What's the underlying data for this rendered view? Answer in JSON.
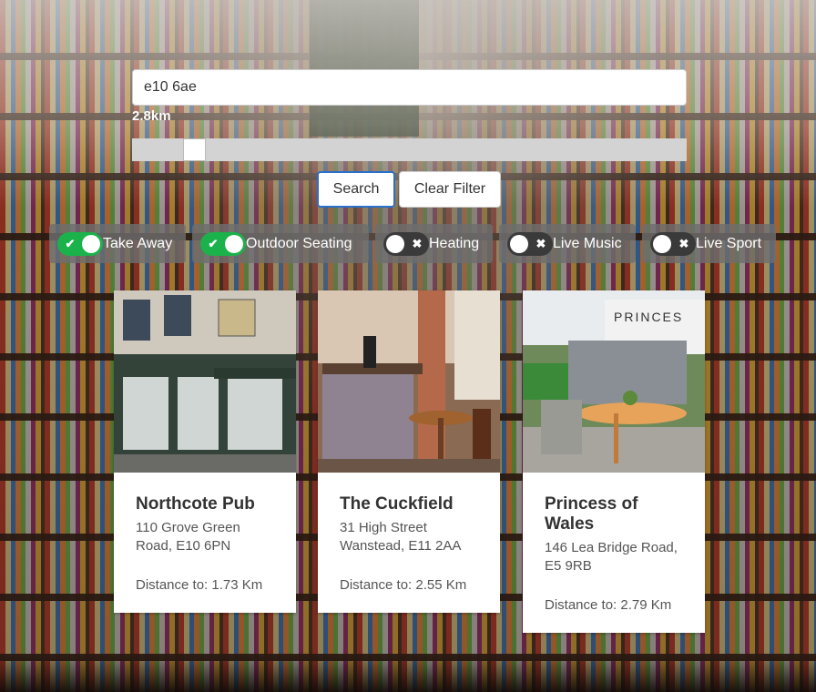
{
  "search": {
    "value": "e10 6ae",
    "distance_label": "2.8km",
    "slider_fraction": 0.11
  },
  "buttons": {
    "search_label": "Search",
    "clear_label": "Clear Filter"
  },
  "filters": [
    {
      "label": "Take Away",
      "on": true,
      "icon": "check-icon"
    },
    {
      "label": "Outdoor Seating",
      "on": true,
      "icon": "check-icon"
    },
    {
      "label": "Heating",
      "on": false,
      "icon": "x-icon"
    },
    {
      "label": "Live Music",
      "on": false,
      "icon": "x-icon"
    },
    {
      "label": "Live Sport",
      "on": false,
      "icon": "x-icon"
    }
  ],
  "pubs": [
    {
      "name": "Northcote Pub",
      "address": "110 Grove Green Road, E10 6PN",
      "distance": "Distance to: 1.73 Km"
    },
    {
      "name": "The Cuckfield",
      "address": "31 High Street Wanstead, E11 2AA",
      "distance": "Distance to: 2.55 Km"
    },
    {
      "name": "Princess of Wales",
      "address": "146 Lea Bridge Road, E5 9RB",
      "distance": "Distance to: 2.79 Km",
      "photo_sign": "PRINCES"
    }
  ],
  "colors": {
    "toggle_on": "#1bb24b",
    "toggle_off": "#3a3a3a",
    "search_focus": "#2a6fc9"
  }
}
